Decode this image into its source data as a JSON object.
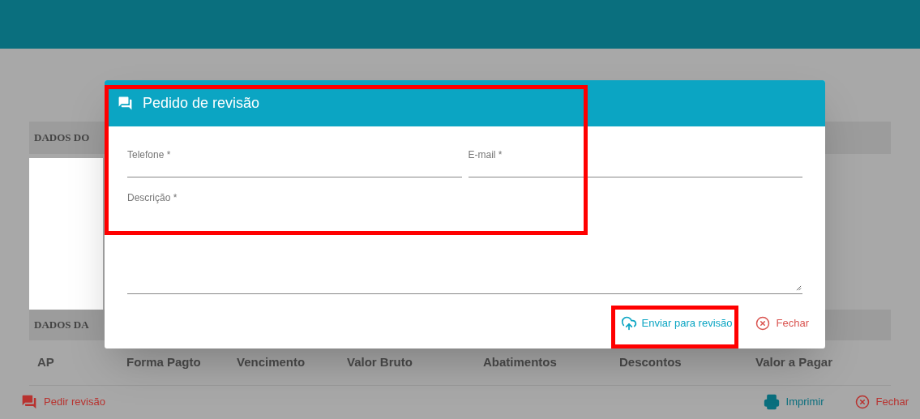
{
  "page": {
    "sections": [
      {
        "title": "DADOS DO"
      },
      {
        "title": "DADOS DA"
      }
    ],
    "table": {
      "columns": [
        "AP",
        "Forma Pagto",
        "Vencimento",
        "Valor Bruto",
        "Abatimentos",
        "Descontos",
        "Valor a Pagar"
      ]
    },
    "footer": {
      "request_review": "Pedir revisão",
      "print": "Imprimir",
      "close": "Fechar"
    }
  },
  "dialog": {
    "title": "Pedido de revisão",
    "highlighted": true,
    "fields": [
      {
        "label": "Telefone *"
      },
      {
        "label": "E-mail *"
      }
    ],
    "description": {
      "label": "Descrição *"
    },
    "send_button": {
      "label": "Enviar para revisão",
      "highlighted": true
    },
    "close_button": {
      "label": "Fechar"
    }
  }
}
